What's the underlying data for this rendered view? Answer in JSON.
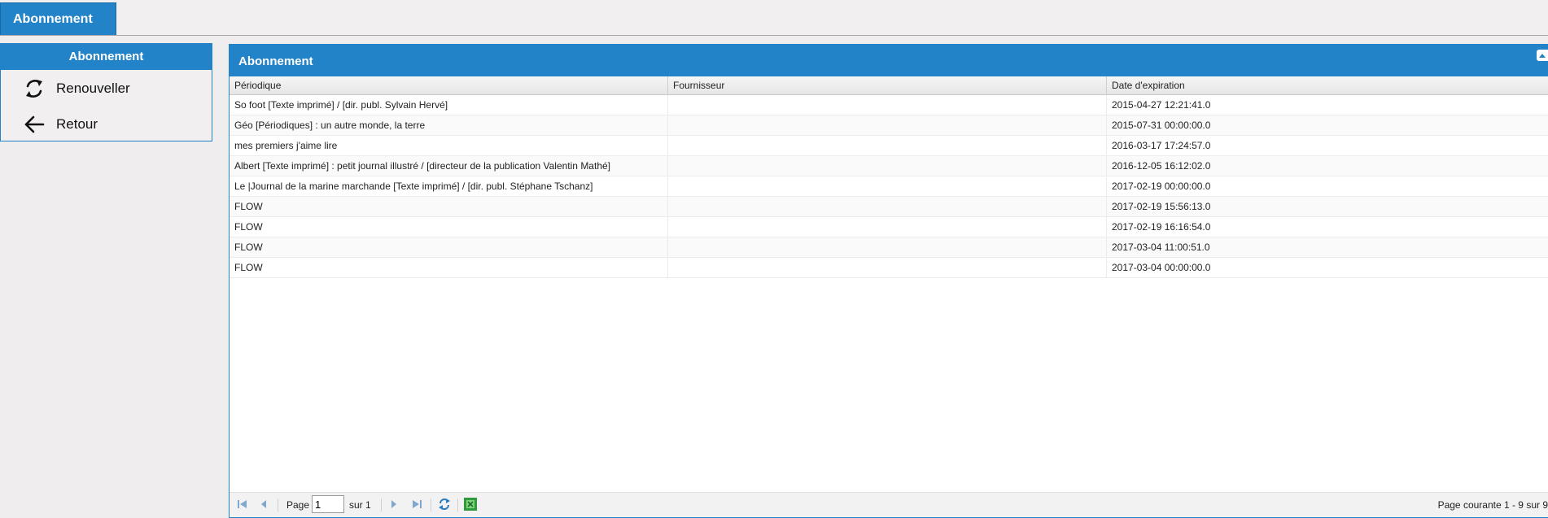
{
  "tab": {
    "label": "Abonnement"
  },
  "sidebar": {
    "title": "Abonnement",
    "actions": [
      {
        "label": "Renouveller",
        "icon": "refresh-icon"
      },
      {
        "label": "Retour",
        "icon": "arrow-left-icon"
      }
    ]
  },
  "grid": {
    "title": "Abonnement",
    "columns": [
      "Périodique",
      "Fournisseur",
      "Date d'expiration"
    ],
    "rows": [
      {
        "periodique": "So foot [Texte imprimé] / [dir. publ. Sylvain Hervé]",
        "fournisseur": "",
        "date": "2015-04-27 12:21:41.0"
      },
      {
        "periodique": "Géo [Périodiques] : un autre monde, la terre",
        "fournisseur": "",
        "date": "2015-07-31 00:00:00.0"
      },
      {
        "periodique": "mes premiers j'aime lire",
        "fournisseur": "",
        "date": "2016-03-17 17:24:57.0"
      },
      {
        "periodique": "Albert [Texte imprimé] : petit journal illustré / [directeur de la publication Valentin Mathé]",
        "fournisseur": "",
        "date": "2016-12-05 16:12:02.0"
      },
      {
        "periodique": "Le |Journal de la marine marchande [Texte imprimé] / [dir. publ. Stéphane Tschanz]",
        "fournisseur": "",
        "date": "2017-02-19 00:00:00.0"
      },
      {
        "periodique": "FLOW",
        "fournisseur": "",
        "date": "2017-02-19 15:56:13.0"
      },
      {
        "periodique": "FLOW",
        "fournisseur": "",
        "date": "2017-02-19 16:16:54.0"
      },
      {
        "periodique": "FLOW",
        "fournisseur": "",
        "date": "2017-03-04 11:00:51.0"
      },
      {
        "periodique": "FLOW",
        "fournisseur": "",
        "date": "2017-03-04 00:00:00.0"
      }
    ],
    "pager": {
      "page_label": "Page",
      "page_value": "1",
      "of_label": "sur 1",
      "info": "Page courante 1 - 9 sur 9"
    }
  },
  "colors": {
    "accent": "#2283c8",
    "background": "#efedee"
  }
}
